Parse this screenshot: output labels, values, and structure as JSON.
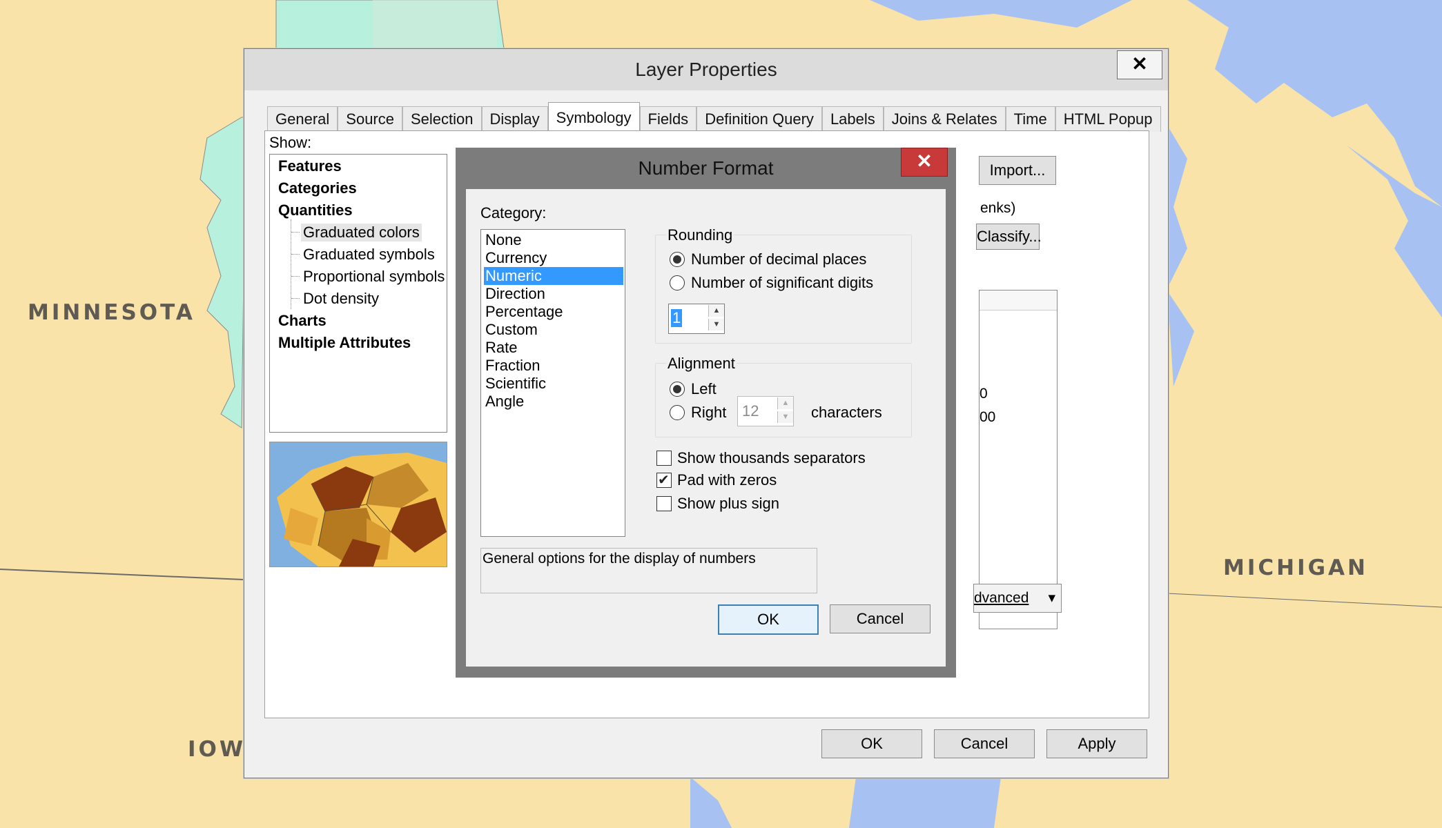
{
  "map": {
    "labels": {
      "minnesota": "MINNESOTA",
      "michigan": "MICHIGAN",
      "iowa": "IOWA"
    },
    "colors": {
      "land": "#f9e3a8",
      "water": "#a7c2f2",
      "state_fill": "#b8f0de"
    }
  },
  "layer_properties": {
    "title": "Layer Properties",
    "close_glyph": "✕",
    "tabs": [
      "General",
      "Source",
      "Selection",
      "Display",
      "Symbology",
      "Fields",
      "Definition Query",
      "Labels",
      "Joins & Relates",
      "Time",
      "HTML Popup"
    ],
    "active_tab": "Symbology",
    "show_label": "Show:",
    "tree": {
      "features": "Features",
      "categories": "Categories",
      "quantities": "Quantities",
      "graduated_colors": "Graduated colors",
      "graduated_symbols": "Graduated symbols",
      "proportional_symbols": "Proportional symbols",
      "dot_density": "Dot density",
      "charts": "Charts",
      "multiple_attributes": "Multiple Attributes"
    },
    "right_panel": {
      "import_label": "Import...",
      "breaks_fragment": "enks)",
      "classify_label": "Classify...",
      "value_fragment_1": "0",
      "value_fragment_2": "00",
      "advanced_label": "dvanced",
      "advanced_arrow": "▾"
    },
    "buttons": {
      "ok": "OK",
      "cancel": "Cancel",
      "apply": "Apply"
    }
  },
  "number_format": {
    "title": "Number Format",
    "close_glyph": "✕",
    "category_label": "Category:",
    "categories": [
      "None",
      "Currency",
      "Numeric",
      "Direction",
      "Percentage",
      "Custom",
      "Rate",
      "Fraction",
      "Scientific",
      "Angle"
    ],
    "selected_category": "Numeric",
    "rounding": {
      "group_label": "Rounding",
      "decimal_places_label": "Number of decimal places",
      "significant_digits_label": "Number of significant digits",
      "selected": "decimal_places",
      "value": "1"
    },
    "alignment": {
      "group_label": "Alignment",
      "left_label": "Left",
      "right_label": "Right",
      "selected": "left",
      "width_value": "12",
      "characters_label": "characters"
    },
    "checkboxes": {
      "thousands_label": "Show thousands separators",
      "thousands_checked": false,
      "pad_zeros_label": "Pad with zeros",
      "pad_zeros_checked": true,
      "plus_sign_label": "Show plus sign",
      "plus_sign_checked": false
    },
    "description": "General options for the display of numbers",
    "buttons": {
      "ok": "OK",
      "cancel": "Cancel"
    }
  }
}
